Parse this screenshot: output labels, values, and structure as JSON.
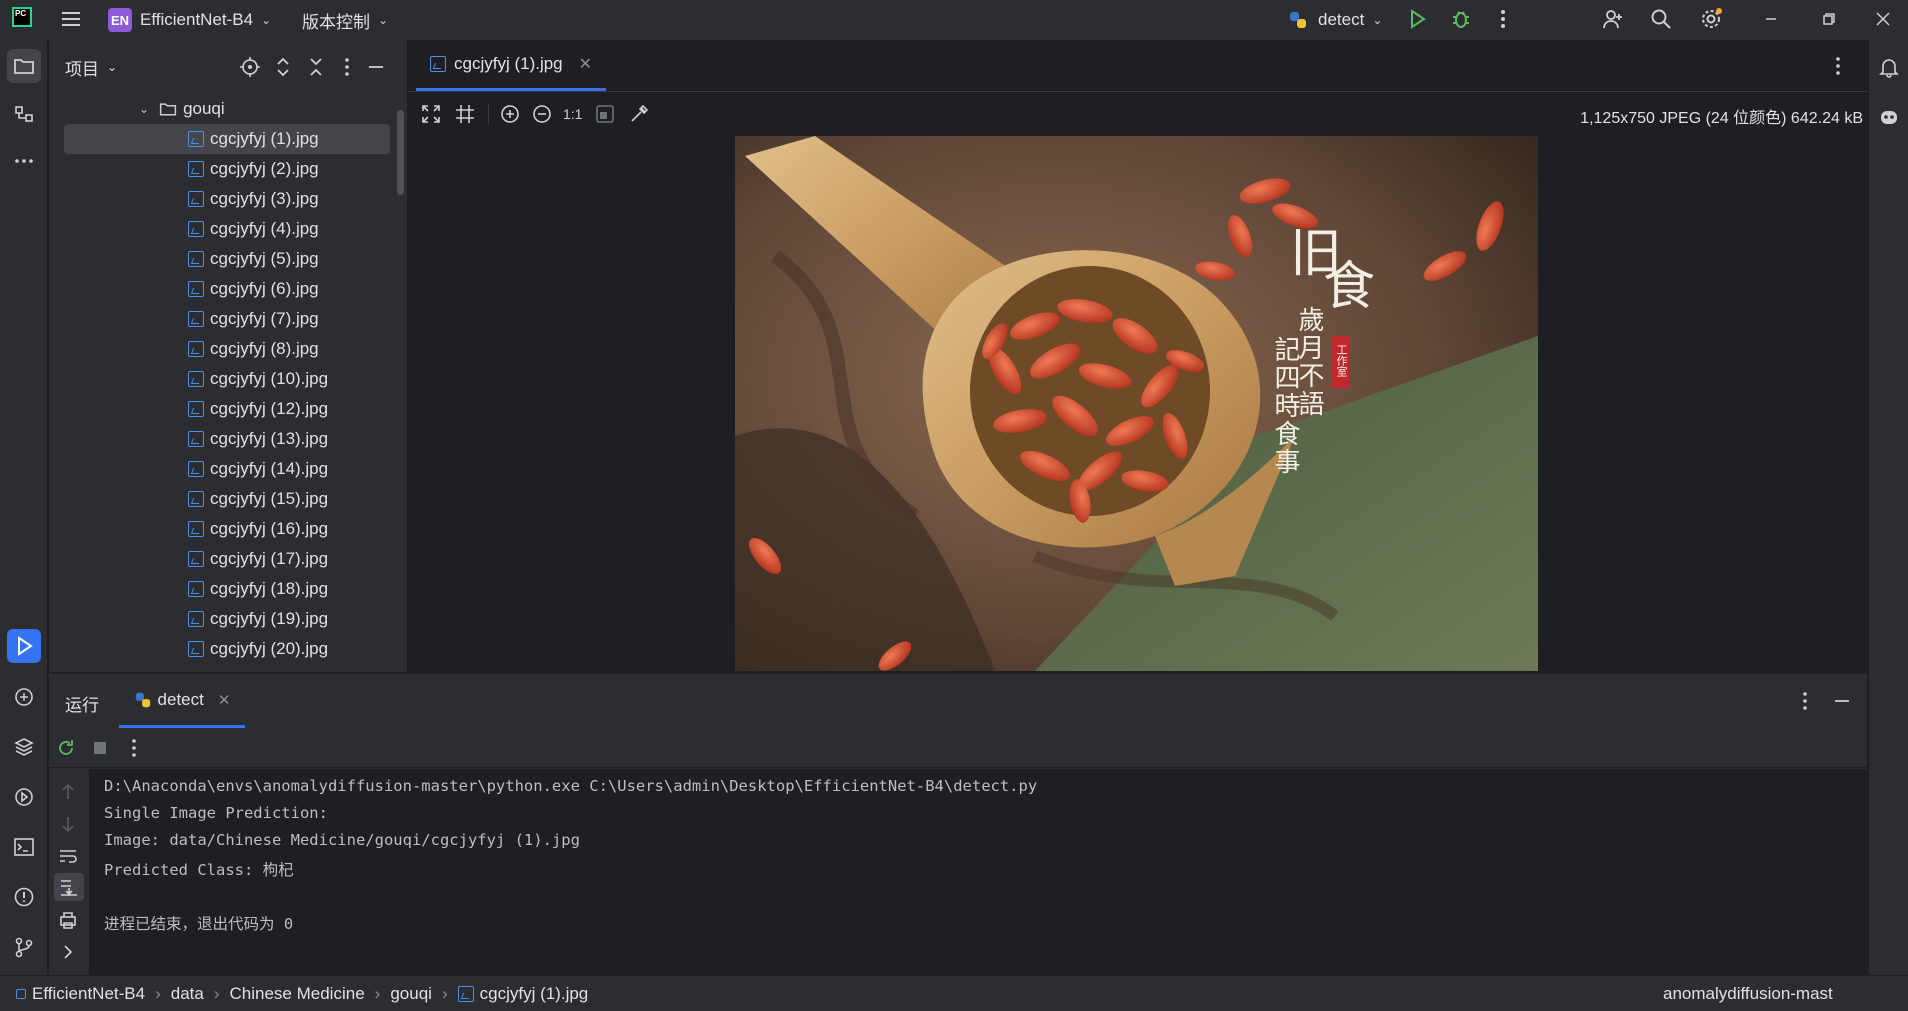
{
  "titlebar": {
    "app_badge": "PC",
    "project_badge": "EN",
    "project_name": "EfficientNet-B4",
    "vcs_label": "版本控制",
    "run_config": "detect"
  },
  "project_panel": {
    "title": "项目",
    "folder": "gouqi",
    "files": [
      "cgcjyfyj (1).jpg",
      "cgcjyfyj (2).jpg",
      "cgcjyfyj (3).jpg",
      "cgcjyfyj (4).jpg",
      "cgcjyfyj (5).jpg",
      "cgcjyfyj (6).jpg",
      "cgcjyfyj (7).jpg",
      "cgcjyfyj (8).jpg",
      "cgcjyfyj (10).jpg",
      "cgcjyfyj (12).jpg",
      "cgcjyfyj (13).jpg",
      "cgcjyfyj (14).jpg",
      "cgcjyfyj (15).jpg",
      "cgcjyfyj (16).jpg",
      "cgcjyfyj (17).jpg",
      "cgcjyfyj (18).jpg",
      "cgcjyfyj (19).jpg",
      "cgcjyfyj (20).jpg"
    ],
    "selected_index": 0
  },
  "editor": {
    "tab_title": "cgcjyfyj (1).jpg",
    "zoom_label": "1:1",
    "image_info": "1,125x750 JPEG (24 位颜色) 642.24 kB",
    "photo_text": {
      "big1": "旧",
      "big2": "食",
      "col1": "記四時食事",
      "col2": "歲月不語",
      "seal": "工作室"
    }
  },
  "run_panel": {
    "title": "运行",
    "tab": "detect",
    "console_lines": [
      "D:\\Anaconda\\envs\\anomalydiffusion-master\\python.exe C:\\Users\\admin\\Desktop\\EfficientNet-B4\\detect.py",
      "Single Image Prediction:",
      "Image: data/Chinese Medicine/gouqi/cgcjyfyj (1).jpg",
      "Predicted Class: 枸杞",
      "",
      "进程已结束，退出代码为 0"
    ]
  },
  "statusbar": {
    "breadcrumbs": [
      "EfficientNet-B4",
      "data",
      "Chinese Medicine",
      "gouqi",
      "cgcjyfyj (1).jpg"
    ],
    "interpreter": "anomalydiffusion-mast"
  },
  "colors": {
    "bg_dark": "#1e1f22",
    "bg_panel": "#2b2d30",
    "accent": "#3574f0",
    "run_green": "#5fb865",
    "project_badge": "#8a5cd6"
  }
}
